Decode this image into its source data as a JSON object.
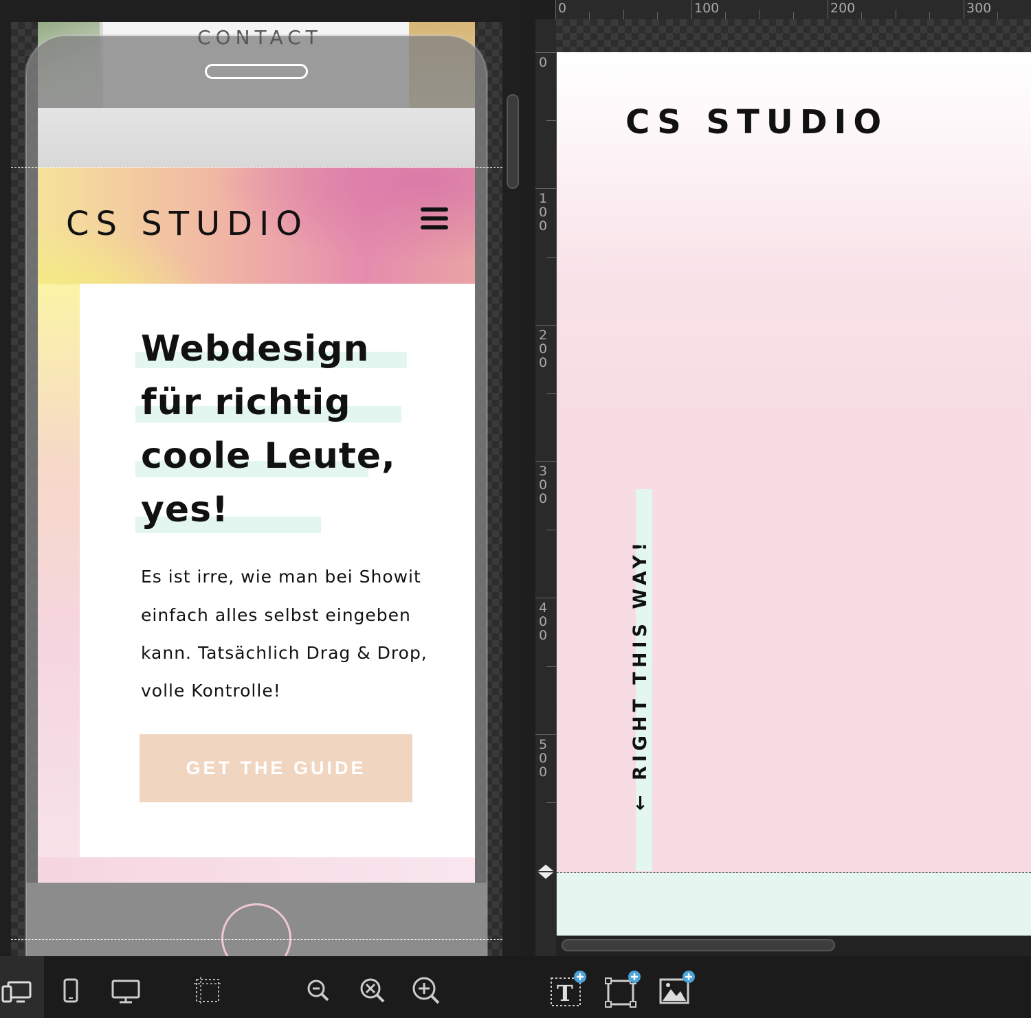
{
  "mobile_preview": {
    "top_nav_label": "CONTACT",
    "logo": "CS STUDIO",
    "headline_lines": [
      "Webdesign",
      "für richtig",
      "coole Leute,",
      "yes!"
    ],
    "body_lines": [
      "Es ist irre, wie man bei Showit",
      "einfach alles selbst eingeben",
      "kann. Tatsächlich Drag & Drop,",
      "volle Kontrolle!"
    ],
    "cta_label": "GET THE GUIDE"
  },
  "desktop_canvas": {
    "logo": "CS STUDIO",
    "vertical_label": "← RIGHT THIS WAY!",
    "ruler_top_labels": [
      "0",
      "100",
      "200",
      "300"
    ],
    "ruler_left_labels": [
      "0",
      "100",
      "200",
      "300",
      "400",
      "500"
    ]
  },
  "toolbar": {
    "icons": [
      "both-views-icon",
      "mobile-view-icon",
      "desktop-view-icon",
      "select-area-icon",
      "zoom-out-icon",
      "zoom-fit-icon",
      "zoom-in-icon",
      "add-text-icon",
      "add-shape-icon",
      "add-image-icon"
    ]
  },
  "colors": {
    "highlight_mint": "#e3f6ef",
    "cta_peach": "#f0d5c0",
    "canvas_pink": "#f7dbe3",
    "add_badge_blue": "#4ea3d8"
  }
}
